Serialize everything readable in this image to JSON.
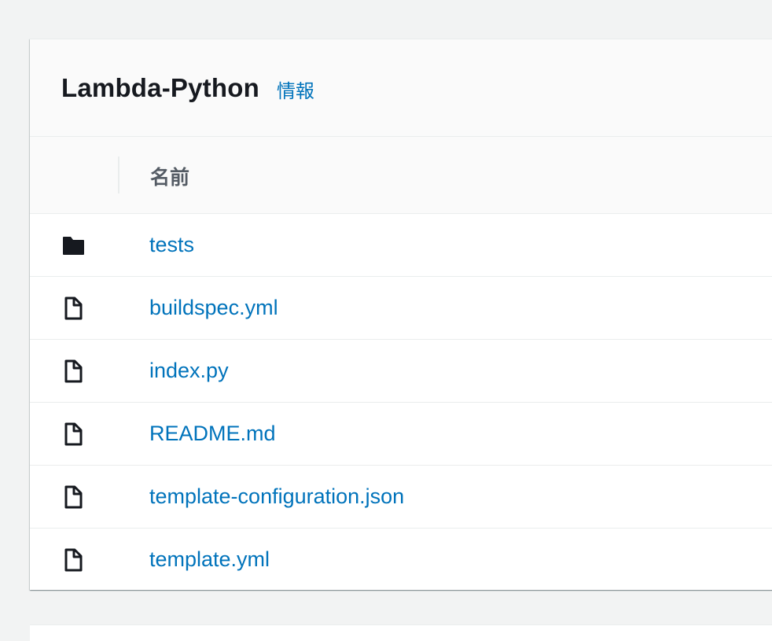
{
  "panel": {
    "title": "Lambda-Python",
    "info_label": "情報"
  },
  "table": {
    "column_name": "名前",
    "rows": [
      {
        "name": "tests",
        "icon": "folder-icon"
      },
      {
        "name": "buildspec.yml",
        "icon": "file-icon"
      },
      {
        "name": "index.py",
        "icon": "file-icon"
      },
      {
        "name": "README.md",
        "icon": "file-icon"
      },
      {
        "name": "template-configuration.json",
        "icon": "file-icon"
      },
      {
        "name": "template.yml",
        "icon": "file-icon"
      }
    ]
  },
  "colors": {
    "link": "#0073bb",
    "title": "#16191f",
    "header_text": "#545b64",
    "background": "#f2f3f3"
  }
}
